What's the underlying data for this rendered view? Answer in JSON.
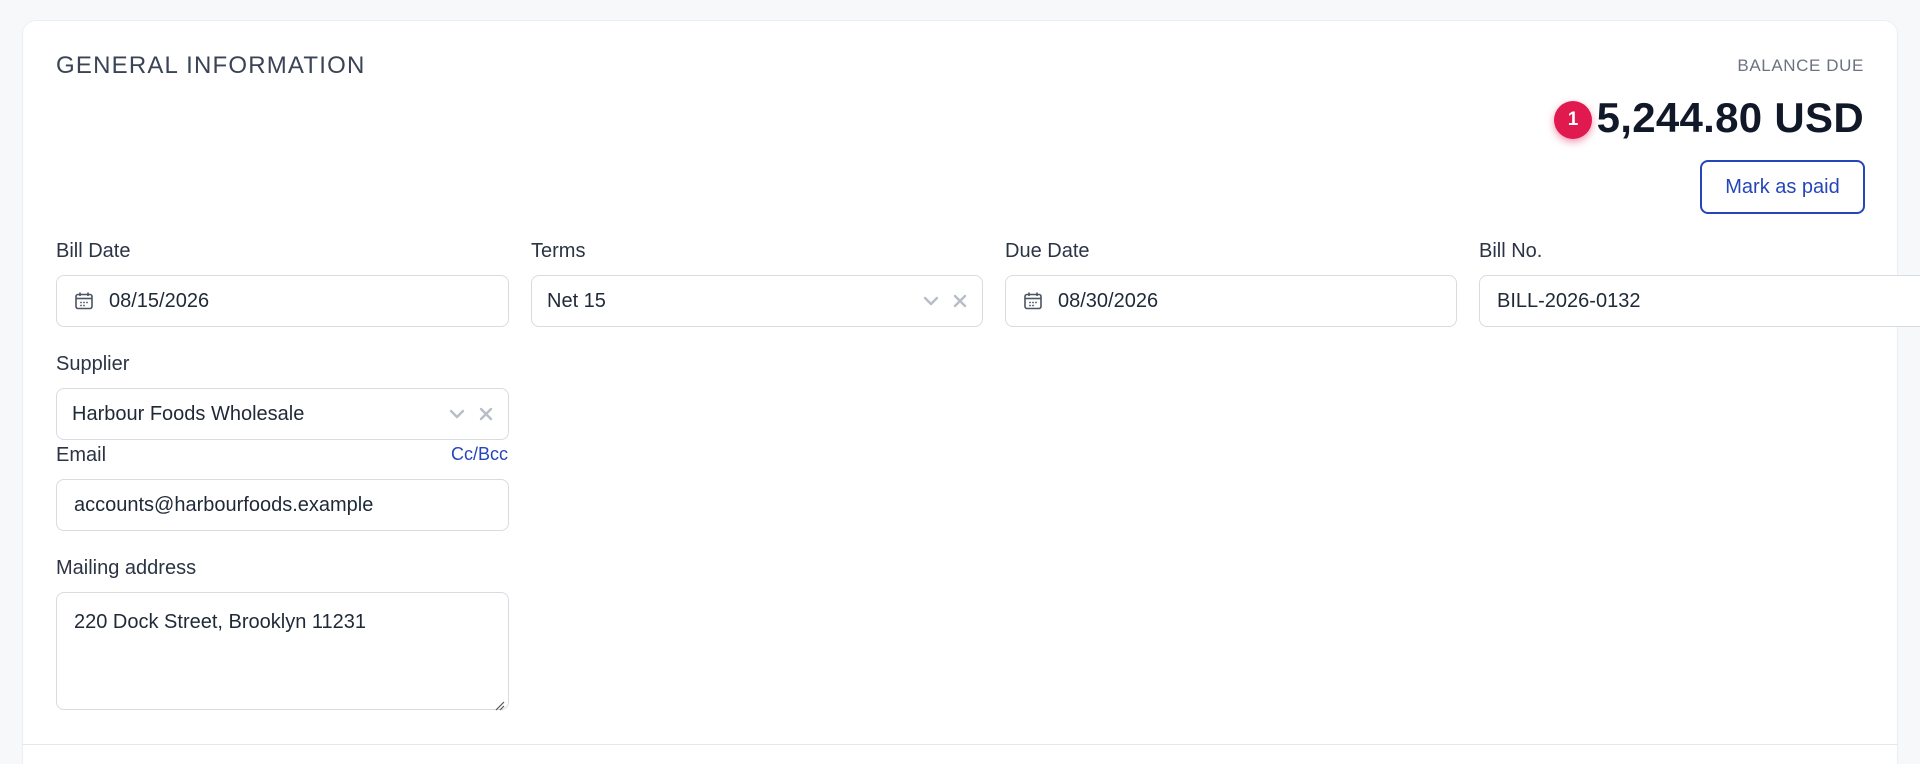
{
  "section": {
    "title": "GENERAL INFORMATION"
  },
  "balance": {
    "label": "BALANCE DUE",
    "badge_count": "1",
    "amount": "5,244.80 USD",
    "mark_paid_label": "Mark as paid"
  },
  "fields": {
    "bill_date": {
      "label": "Bill Date",
      "value": "08/15/2026"
    },
    "terms": {
      "label": "Terms",
      "value": "Net 15"
    },
    "due_date": {
      "label": "Due Date",
      "value": "08/30/2026"
    },
    "bill_no": {
      "label": "Bill No.",
      "value": "BILL-2026-0132"
    },
    "supplier": {
      "label": "Supplier",
      "value": "Harbour Foods Wholesale"
    },
    "email": {
      "label": "Email",
      "value": "accounts@harbourfoods.example",
      "cc_bcc_label": "Cc/Bcc"
    },
    "mailing_address": {
      "label": "Mailing address",
      "value": "220 Dock Street, Brooklyn 11231"
    }
  },
  "icons": {
    "calendar": "calendar-icon",
    "chevron": "chevron-down-icon",
    "clear": "close-icon"
  },
  "colors": {
    "accent": "#2546b8",
    "badge": "#e0194f",
    "border": "#d7dbe2"
  }
}
